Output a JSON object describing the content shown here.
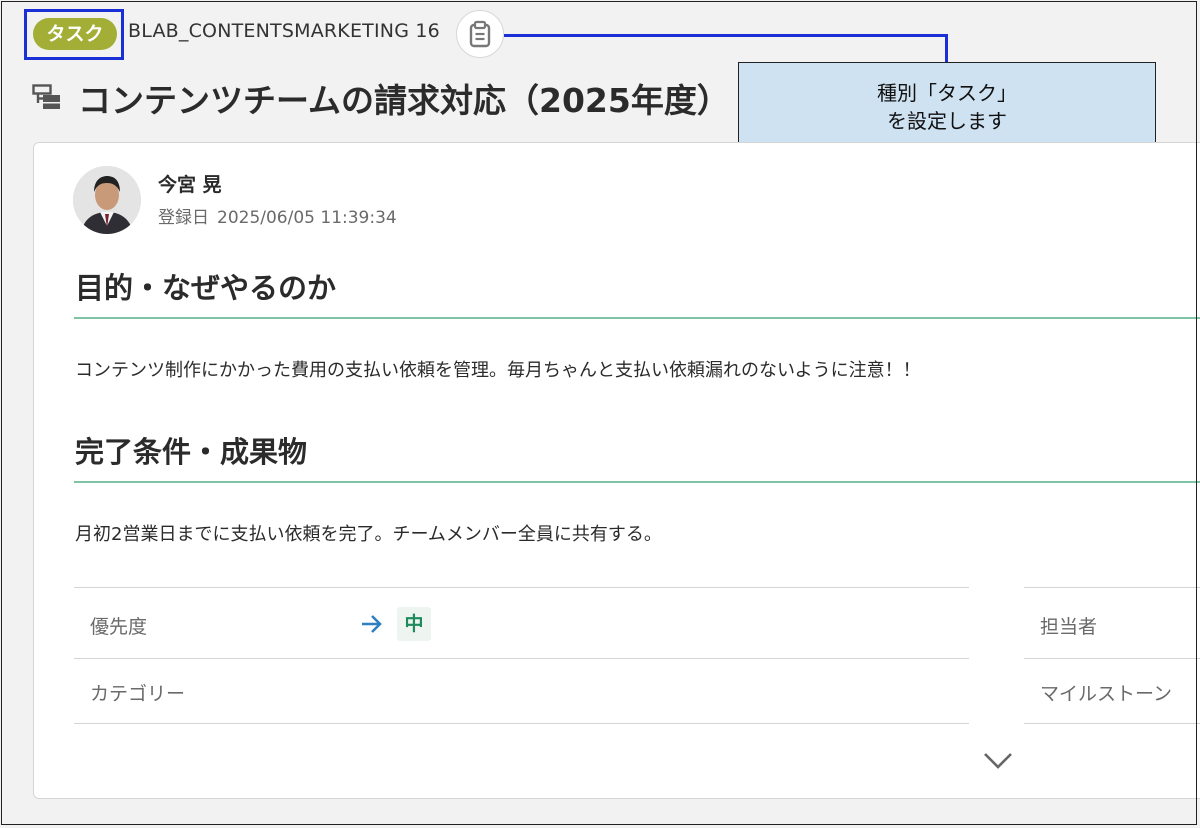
{
  "header": {
    "type_badge": "タスク",
    "task_id": "BLAB_CONTENTSMARKETING 16",
    "page_title": "コンテンツチームの請求対応（2025年度）"
  },
  "callout": {
    "line1": "種別「タスク」",
    "line2": "を設定します"
  },
  "author": {
    "name": "今宮 晃",
    "registered_label": "登録日",
    "registered_at": "2025/06/05 11:39:34"
  },
  "sections": [
    {
      "heading": "目的・なぜやるのか",
      "body": "コンテンツ制作にかかった費用の支払い依頼を管理。毎月ちゃんと支払い依頼漏れのないように注意！！"
    },
    {
      "heading": "完了条件・成果物",
      "body": "月初2営業日までに支払い依頼を完了。チームメンバー全員に共有する。"
    }
  ],
  "properties": {
    "priority_label": "優先度",
    "priority_value": "中",
    "category_label": "カテゴリー",
    "assignee_label": "担当者",
    "milestone_label": "マイルストーン"
  },
  "colors": {
    "badge": "#a2ae35",
    "highlight": "#1a2fd6",
    "callout_bg": "#cfe2f2",
    "section_rule": "#7fc4a4",
    "priority_arrow": "#2f7fc1",
    "priority_text": "#1f8a5a"
  },
  "icons": {
    "clipboard": "clipboard-icon",
    "title": "task-type-icon",
    "priority": "arrow-right-icon",
    "expand": "chevron-down-icon"
  }
}
